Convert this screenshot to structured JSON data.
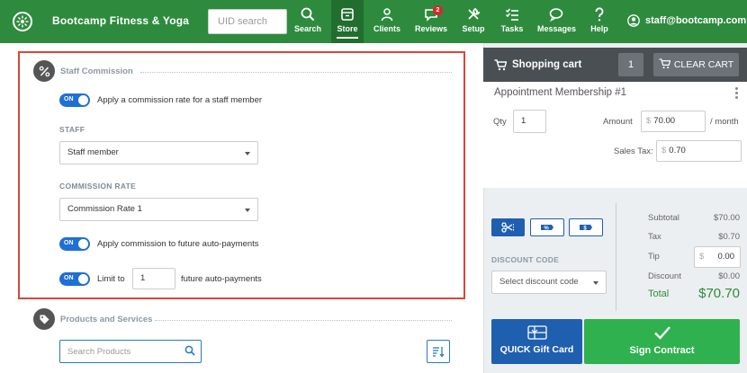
{
  "header": {
    "brand": "Bootcamp Fitness & Yoga",
    "uid_placeholder": "UID search",
    "nav": [
      {
        "label": "Search",
        "icon": "search-icon"
      },
      {
        "label": "Store",
        "icon": "store-icon",
        "active": true
      },
      {
        "label": "Clients",
        "icon": "clients-icon"
      },
      {
        "label": "Reviews",
        "icon": "reviews-icon",
        "badge": "2"
      },
      {
        "label": "Setup",
        "icon": "setup-icon"
      },
      {
        "label": "Tasks",
        "icon": "tasks-icon"
      },
      {
        "label": "Messages",
        "icon": "messages-icon"
      },
      {
        "label": "Help",
        "icon": "help-icon"
      }
    ],
    "user": "staff@bootcamp.com"
  },
  "staff_commission": {
    "title": "Staff Commission",
    "apply_toggle_label": "ON",
    "apply_text": "Apply a commission rate for a staff member",
    "staff_label": "STAFF",
    "staff_value": "Staff member",
    "rate_label": "COMMISSION RATE",
    "rate_value": "Commission Rate 1",
    "future_toggle_label": "ON",
    "future_text": "Apply commission to future auto-payments",
    "limit_toggle_label": "ON",
    "limit_prefix": "Limit to",
    "limit_value": "1",
    "limit_suffix": "future auto-payments"
  },
  "products": {
    "title": "Products and Services",
    "search_placeholder": "Search Products"
  },
  "cart": {
    "title": "Shopping cart",
    "count": "1",
    "clear_label": "CLEAR CART",
    "item": {
      "title": "Appointment Membership #1",
      "qty_label": "Qty",
      "qty_value": "1",
      "amount_label": "Amount",
      "amount_value": "70.00",
      "amount_suffix": "/ month",
      "tax_label": "Sales Tax:",
      "tax_value": "0.70",
      "currency": "$"
    },
    "discount_label": "DISCOUNT CODE",
    "discount_placeholder": "Select discount code",
    "totals": {
      "subtotal_label": "Subtotal",
      "subtotal": "$70.00",
      "tax_label": "Tax",
      "tax": "$0.70",
      "tip_label": "Tip",
      "tip": "0.00",
      "discount_label": "Discount",
      "discount": "$0.00",
      "total_label": "Total",
      "total": "$70.70"
    },
    "gift_label": "QUICK Gift Card",
    "sign_label": "Sign Contract"
  },
  "colors": {
    "brand_green": "#2e8b3e",
    "toggle_blue": "#1f6fd6",
    "highlight_red": "#d9473a",
    "sign_green": "#2fb150",
    "gift_blue": "#1f5fb0"
  }
}
